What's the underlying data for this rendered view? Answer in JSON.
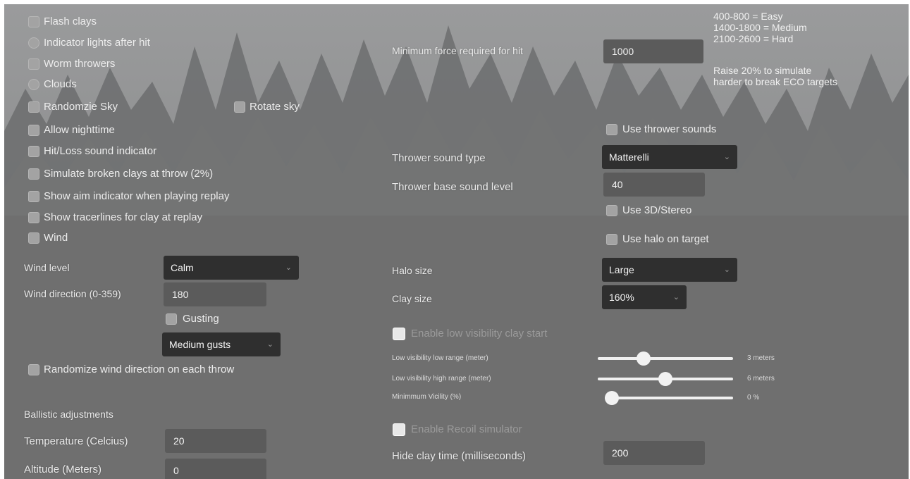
{
  "left": {
    "checkboxes": [
      {
        "label": "Flash clays"
      },
      {
        "label": "Indicator lights after hit"
      },
      {
        "label": "Worm throwers"
      },
      {
        "label": "Clouds"
      },
      {
        "label": "Randomzie Sky"
      },
      {
        "label": "Rotate sky"
      },
      {
        "label": "Allow nighttime"
      },
      {
        "label": "Hit/Loss sound indicator"
      },
      {
        "label": "Simulate broken clays at throw (2%)"
      },
      {
        "label": "Show aim indicator when playing replay"
      },
      {
        "label": "Show tracerlines for clay at replay"
      },
      {
        "label": "Wind"
      }
    ],
    "wind_level_label": "Wind level",
    "wind_level_value": "Calm",
    "wind_direction_label": "Wind direction (0-359)",
    "wind_direction_value": "180",
    "gusting_label": "Gusting",
    "gust_type_value": "Medium gusts",
    "randomize_wind_label": "Randomize wind direction on each throw",
    "ballistic_heading": "Ballistic adjustments",
    "temperature_label": "Temperature (Celcius)",
    "temperature_value": "20",
    "altitude_label": "Altitude (Meters)",
    "altitude_value": "0"
  },
  "right": {
    "min_force_label": "Minimum force required for hit",
    "min_force_value": "1000",
    "info_lines": [
      "400-800 = Easy",
      "1400-1800 = Medium",
      "2100-2600 = Hard"
    ],
    "info_note_lines": [
      "Raise 20% to simulate",
      "harder to break ECO targets"
    ],
    "use_thrower_sounds_label": "Use thrower sounds",
    "thrower_sound_type_label": "Thrower sound type",
    "thrower_sound_type_value": "Matterelli",
    "thrower_base_level_label": "Thrower base sound level",
    "thrower_base_level_value": "40",
    "use_3d_label": "Use 3D/Stereo",
    "use_halo_label": "Use halo on target",
    "halo_size_label": "Halo size",
    "halo_size_value": "Large",
    "clay_size_label": "Clay size",
    "clay_size_value": "160%",
    "enable_low_vis_label": "Enable low visibility clay start",
    "low_vis_low_label": "Low visibility low range (meter)",
    "low_vis_low_value_text": "3 meters",
    "low_vis_low_fraction": 0.32,
    "low_vis_high_label": "Low visibility high range (meter)",
    "low_vis_high_value_text": "6 meters",
    "low_vis_high_fraction": 0.5,
    "min_visibility_label": "Minimmum Vicility (%)",
    "min_visibility_value_text": "0 %",
    "min_visibility_fraction": 0.0,
    "enable_recoil_label": "Enable Recoil simulator",
    "hide_clay_time_label": "Hide clay time (milliseconds)",
    "hide_clay_time_value": "200"
  },
  "icons": {
    "dropdown": "chevron-down-icon"
  },
  "colors": {
    "input_bg": "#5b5b5b",
    "select_bg": "#2f2f2f",
    "text": "#ececec"
  }
}
